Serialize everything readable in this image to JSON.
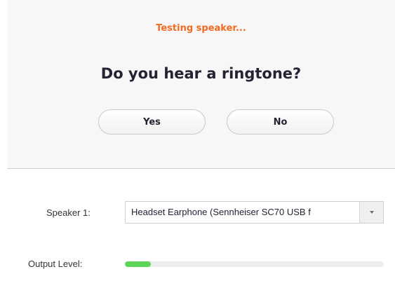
{
  "status_text": "Testing speaker...",
  "question": "Do you hear a ringtone?",
  "buttons": {
    "yes": "Yes",
    "no": "No"
  },
  "speaker": {
    "label": "Speaker 1:",
    "selected": "Headset Earphone (Sennheiser SC70 USB f"
  },
  "output_level": {
    "label": "Output Level:",
    "fraction": 0.1
  },
  "colors": {
    "accent": "#f26b21",
    "level": "#5dd45a"
  }
}
